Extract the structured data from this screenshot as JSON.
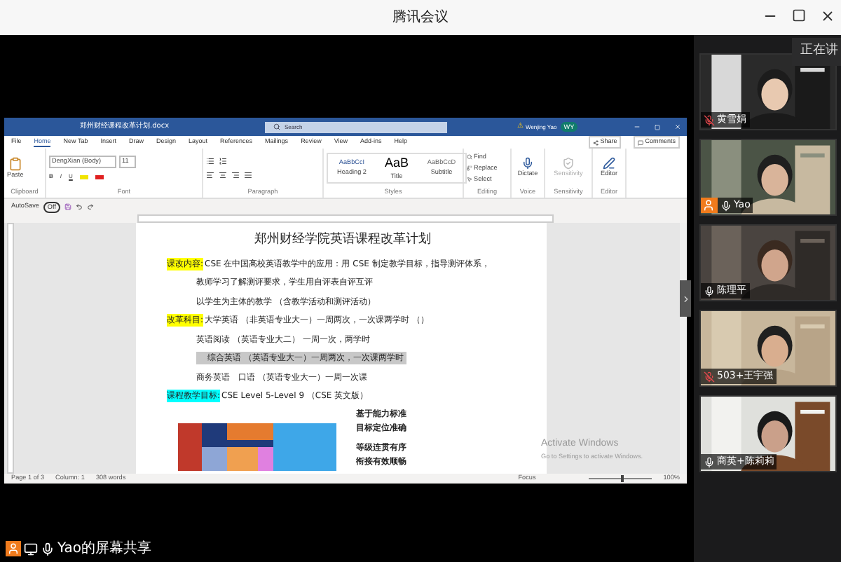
{
  "window": {
    "title": "腾讯会议"
  },
  "shared_screen": {
    "word": {
      "file_name": "郑州财经课程改革计划.docx",
      "search_placeholder": "Search",
      "warning": "⚠",
      "user": "Wenjing Yao",
      "initials": "WY",
      "tabs": [
        {
          "label": "File",
          "selected": false
        },
        {
          "label": "Home",
          "selected": true
        },
        {
          "label": "New Tab",
          "selected": false
        },
        {
          "label": "Insert",
          "selected": false
        },
        {
          "label": "Draw",
          "selected": false
        },
        {
          "label": "Design",
          "selected": false
        },
        {
          "label": "Layout",
          "selected": false
        },
        {
          "label": "References",
          "selected": false
        },
        {
          "label": "Mailings",
          "selected": false
        },
        {
          "label": "Review",
          "selected": false
        },
        {
          "label": "View",
          "selected": false
        },
        {
          "label": "Add-ins",
          "selected": false
        },
        {
          "label": "Help",
          "selected": false
        }
      ],
      "share": "Share",
      "comments": "Comments",
      "paste": "Paste",
      "font": "DengXian (Body)",
      "font_size": "11",
      "font_buttons": [
        "B",
        "I",
        "U"
      ],
      "styles": [
        {
          "sample": "AaBbCcI",
          "name": "Heading 2",
          "kind": "heading"
        },
        {
          "sample": "AaB",
          "name": "Title",
          "kind": "title"
        },
        {
          "sample": "AaBbCcD",
          "name": "Subtitle",
          "kind": "subtitle"
        }
      ],
      "editing": [
        {
          "label": "Find",
          "kind": "find"
        },
        {
          "label": "Replace",
          "kind": "replace"
        },
        {
          "label": "Select",
          "kind": "select"
        }
      ],
      "big_buttons": [
        {
          "label": "Dictate",
          "kind": "dictate",
          "disabled": false
        },
        {
          "label": "Sensitivity",
          "kind": "sensitivity",
          "disabled": true
        },
        {
          "label": "Editor",
          "kind": "editor",
          "disabled": false
        }
      ],
      "groups": [
        "Clipboard",
        "Font",
        "Paragraph",
        "Styles",
        "Editing",
        "Voice",
        "Sensitivity",
        "Editor"
      ],
      "autosave": {
        "label": "AutoSave",
        "state": "Off"
      },
      "doc": {
        "title": "郑州财经学院英语课程改革计划",
        "lines": [
          {
            "label": "课改内容:",
            "color": "#ffff00",
            "text": "CSE 在中国高校英语教学中的应用：用 CSE 制定教学目标，指导测评体系，",
            "selected": false
          },
          {
            "text": "教师学习了解测评要求，学生用自评表自评互评",
            "selected": false
          },
          {
            "text": "以学生为主体的教学 （含教学活动和测评活动）",
            "selected": false
          },
          {
            "label": "改革科目:",
            "color": "#ffff00",
            "text": "大学英语 （非英语专业大一）一周两次，一次课两学时 （）",
            "selected": false
          },
          {
            "text": "英语阅读 （英语专业大二） 一周一次，两学时",
            "selected": false
          },
          {
            "text": "综合英语 （英语专业大一）一周两次，一次课两学时",
            "selected": true
          },
          {
            "text": "商务英语　口语 （英语专业大一）一周一次课",
            "selected": false
          },
          {
            "label": "课程教学目标:",
            "color": "#00ffff",
            "text": "CSE Level 5-Level 9 （CSE 英文版）",
            "selected": false
          }
        ],
        "side_notes": [
          "基于能力标准",
          "目标定位准确",
          "等级连贯有序",
          "衔接有效顺畅"
        ]
      },
      "status": [
        "Page 1 of 3",
        "Column: 1",
        "308 words"
      ],
      "focus": "Focus",
      "zoom_slider": {
        "level": 0.5
      },
      "zoom_level": "100%",
      "activation": {
        "title": "Activate Windows",
        "subtitle": "Go to Settings to activate Windows."
      }
    }
  },
  "speaking_label": "正在讲",
  "participants": [
    {
      "name": "黄雪娟",
      "muted": true,
      "host": false
    },
    {
      "name": "Yao",
      "muted": false,
      "host": true
    },
    {
      "name": "陈理平",
      "muted": false,
      "host": false
    },
    {
      "name": "503+王宇强",
      "muted": true,
      "host": false
    },
    {
      "name": "商英+陈莉莉",
      "muted": false,
      "host": false
    }
  ],
  "share_banner": "Yao的屏幕共享"
}
